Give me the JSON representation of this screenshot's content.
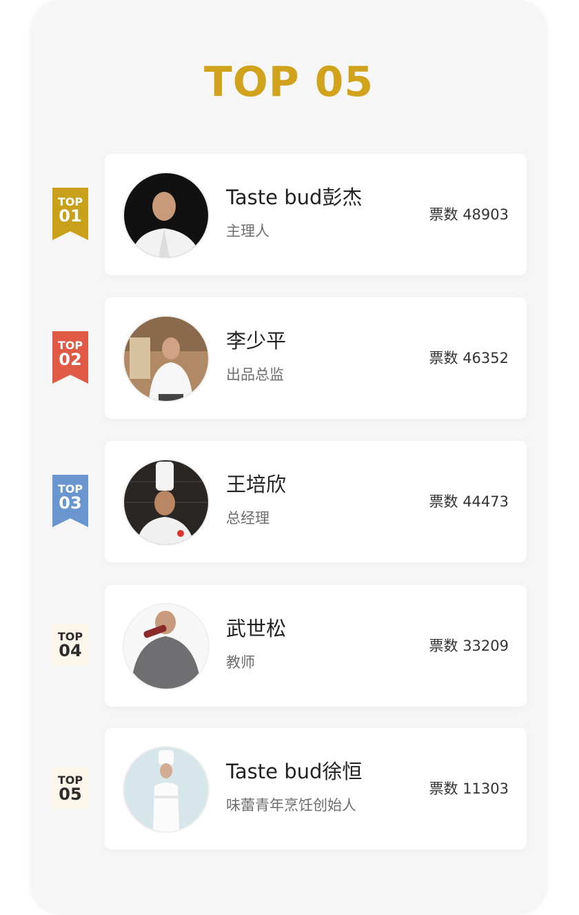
{
  "header": {
    "title": "TOP 05"
  },
  "colors": {
    "title": "#d1a21c",
    "badge_1": "#c9a01a",
    "badge_2": "#e05a45",
    "badge_3": "#6a96cf",
    "badge_plain": "#fbf5ea"
  },
  "ranking": [
    {
      "badge_top": "TOP",
      "badge_num": "01",
      "name": "Taste bud彭杰",
      "role": "主理人",
      "votes": "票数 48903",
      "avatar_icon": "chef-portrait-icon"
    },
    {
      "badge_top": "TOP",
      "badge_num": "02",
      "name": "李少平",
      "role": "出品总监",
      "votes": "票数 46352",
      "avatar_icon": "chef-portrait-icon"
    },
    {
      "badge_top": "TOP",
      "badge_num": "03",
      "name": "王培欣",
      "role": "总经理",
      "votes": "票数 44473",
      "avatar_icon": "chef-portrait-icon"
    },
    {
      "badge_top": "TOP",
      "badge_num": "04",
      "name": "武世松",
      "role": "教师",
      "votes": "票数 33209",
      "avatar_icon": "chef-portrait-icon"
    },
    {
      "badge_top": "TOP",
      "badge_num": "05",
      "name": "Taste bud徐恒",
      "role": "味蕾青年烹饪创始人",
      "votes": "票数 11303",
      "avatar_icon": "chef-portrait-icon"
    }
  ]
}
